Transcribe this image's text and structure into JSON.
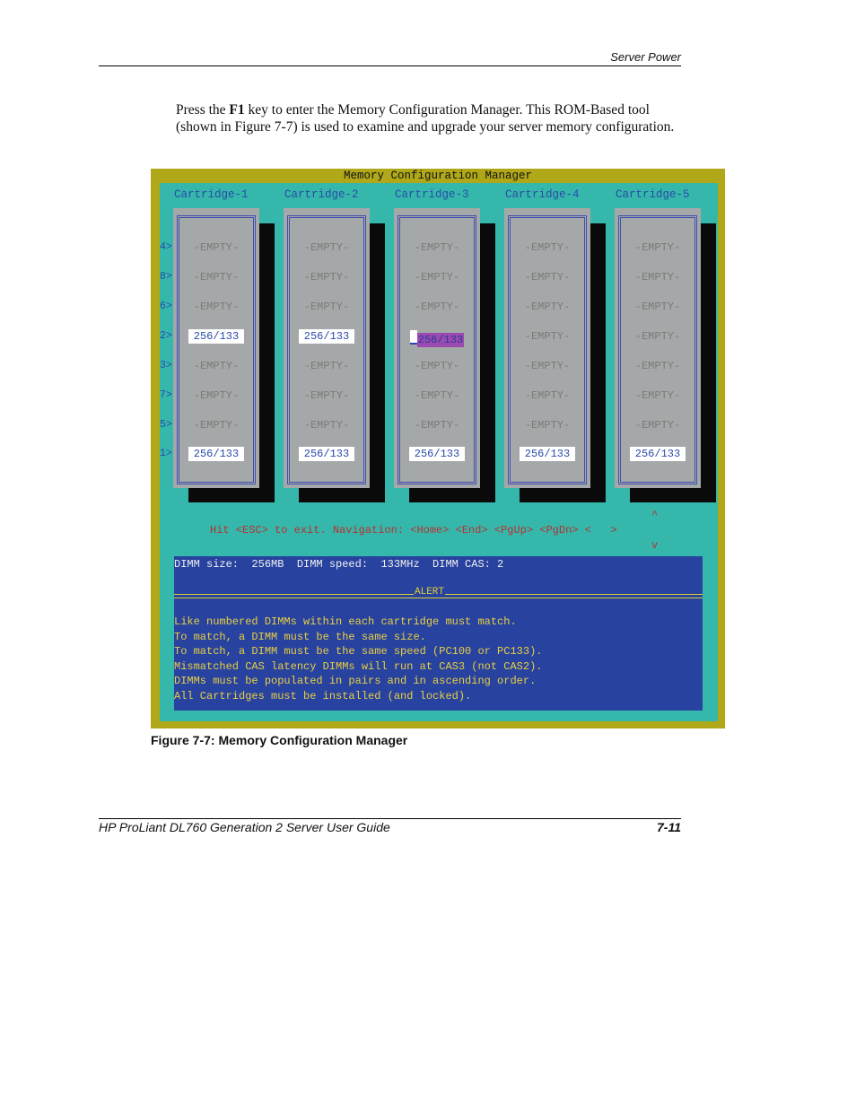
{
  "header": {
    "section": "Server Power"
  },
  "body": {
    "para_pre": "Press the ",
    "para_key": "F1",
    "para_post": " key to enter the Memory Configuration Manager. This ROM-Based tool (shown in Figure 7-7) is used to examine and upgrade your server memory configuration."
  },
  "screen": {
    "title": "Memory Configuration Manager",
    "row_labels": [
      "4>",
      "8>",
      "6>",
      "2>",
      "3>",
      "7>",
      "5>",
      "1>"
    ],
    "cartridges": [
      {
        "label": "Cartridge-1",
        "slots": [
          "-EMPTY-",
          "-EMPTY-",
          "-EMPTY-",
          "256/133",
          "-EMPTY-",
          "-EMPTY-",
          "-EMPTY-",
          "256/133"
        ]
      },
      {
        "label": "Cartridge-2",
        "slots": [
          "-EMPTY-",
          "-EMPTY-",
          "-EMPTY-",
          "256/133",
          "-EMPTY-",
          "-EMPTY-",
          "-EMPTY-",
          "256/133"
        ]
      },
      {
        "label": "Cartridge-3",
        "slots": [
          "-EMPTY-",
          "-EMPTY-",
          "-EMPTY-",
          "256/133",
          "-EMPTY-",
          "-EMPTY-",
          "-EMPTY-",
          "256/133"
        ],
        "selected_slot": 3
      },
      {
        "label": "Cartridge-4",
        "slots": [
          "-EMPTY-",
          "-EMPTY-",
          "-EMPTY-",
          "-EMPTY-",
          "-EMPTY-",
          "-EMPTY-",
          "-EMPTY-",
          "256/133"
        ]
      },
      {
        "label": "Cartridge-5",
        "slots": [
          "-EMPTY-",
          "-EMPTY-",
          "-EMPTY-",
          "-EMPTY-",
          "-EMPTY-",
          "-EMPTY-",
          "-EMPTY-",
          "256/133"
        ]
      }
    ],
    "navigation": "Hit <ESC> to exit. Navigation: <Home> <End> <PgUp> <PgDn> <   >",
    "arrow_up": "^",
    "arrow_down": "v",
    "dimm_info": "DIMM size:  256MB  DIMM speed:  133MHz  DIMM CAS: 2",
    "alert_label": "ALERT",
    "alert_messages": [
      "Like numbered DIMMs within each cartridge must match.",
      "To match, a DIMM must be the same size.",
      "To match, a DIMM must be the same speed (PC100 or PC133).",
      "Mismatched CAS latency DIMMs will run at CAS3 (not CAS2).",
      "DIMMs must be populated in pairs and in ascending order.",
      "All Cartridges must be installed (and locked)."
    ],
    "colors": {
      "frame": "#b0a818",
      "background": "#35b8ab",
      "panel": "#2842a0",
      "nav_text": "#b83030",
      "alert_text": "#e8d040",
      "selection": "#9a4ab0"
    }
  },
  "caption": "Figure 7-7:  Memory Configuration Manager",
  "footer": {
    "title": "HP ProLiant DL760 Generation 2 Server User Guide",
    "page": "7-11"
  }
}
